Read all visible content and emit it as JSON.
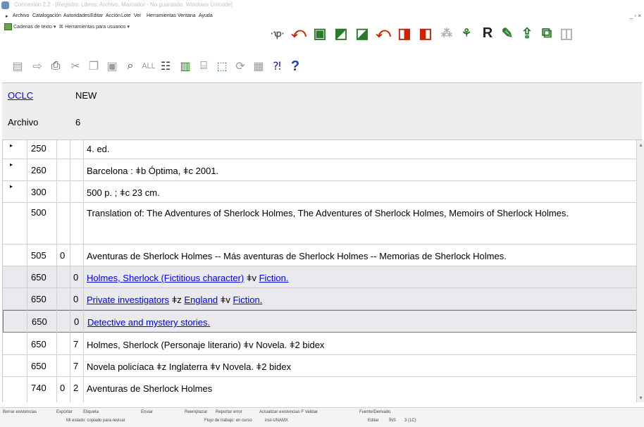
{
  "window": {
    "title": "Connexion 2.2 - [Registro: Libros; Archivo, Marcador - No guardado, Windows Unicode]"
  },
  "menubar": {
    "items": [
      "Archivo",
      "Catalogación",
      "Autoridades",
      "Editar",
      "Acción",
      "Lote",
      "Ver",
      "Herramientas",
      "Ventana",
      "Ayuda"
    ]
  },
  "toolbar": {
    "text_strings": "Cadenas de texto",
    "user_tools": "Herramientas para usuarios"
  },
  "info": {
    "oclc_label": "OCLC",
    "oclc_value": "NEW",
    "archivo_label": "Archivo",
    "archivo_value": "6"
  },
  "rows": [
    {
      "tag": "250",
      "ind1": "",
      "ind2": "",
      "text": "4. ed."
    },
    {
      "tag": "260",
      "ind1": "",
      "ind2": "",
      "text": "Barcelona : ǂb Óptima, ǂc 2001."
    },
    {
      "tag": "300",
      "ind1": "",
      "ind2": "",
      "text": "500 p. ; ǂc 23 cm."
    },
    {
      "tag": "500",
      "ind1": "",
      "ind2": "",
      "text": "Translation of: The Adventures of Sherlock Holmes, The Adventures of Sherlock Holmes, Memoirs of Sherlock Holmes."
    },
    {
      "tag": "505",
      "ind1": "0",
      "ind2": "",
      "text": "Aventuras de Sherlock Holmes -- Más aventuras de Sherlock Holmes -- Memorias de Sherlock Holmes."
    },
    {
      "tag": "650",
      "ind1": "",
      "ind2": "0",
      "link1": "Holmes, Sherlock (Fictitious character)",
      "sub1": "ǂv",
      "link2": "Fiction."
    },
    {
      "tag": "650",
      "ind1": "",
      "ind2": "0",
      "link1": "Private investigators",
      "sub1": "ǂz",
      "link2": "England",
      "sub2": "ǂv",
      "link3": "Fiction."
    },
    {
      "tag": "650",
      "ind1": "",
      "ind2": "0",
      "link1": "Detective and mystery stories."
    },
    {
      "tag": "650",
      "ind1": "",
      "ind2": "7",
      "text": "Holmes, Sherlock (Personaje literario) ǂv Novela. ǂ2 bidex"
    },
    {
      "tag": "650",
      "ind1": "",
      "ind2": "7",
      "text": "Novela policíaca ǂz Inglaterra ǂv Novela. ǂ2 bidex"
    },
    {
      "tag": "740",
      "ind1": "0",
      "ind2": "2",
      "text": "Aventuras de Sherlock Holmes"
    }
  ],
  "statusbar": {
    "line1": [
      "Borrar existencias",
      "Exportar",
      "Etiqueta",
      "Enviar",
      "Reemplazar",
      "Reportar error",
      "Actualizar existencias F Validar",
      "Fuente/Derivado"
    ],
    "line2": [
      "Mi estado: copiado para revisar",
      "Flujo de trabajo: en curso",
      "inst-UNAMX",
      "Editar",
      "ÍNS",
      "3 (1C)"
    ]
  },
  "colors": {
    "link": "#0000ee",
    "shade": "#e9e9ee",
    "accent_red": "#cc2200",
    "accent_green": "#2a7a2a"
  }
}
